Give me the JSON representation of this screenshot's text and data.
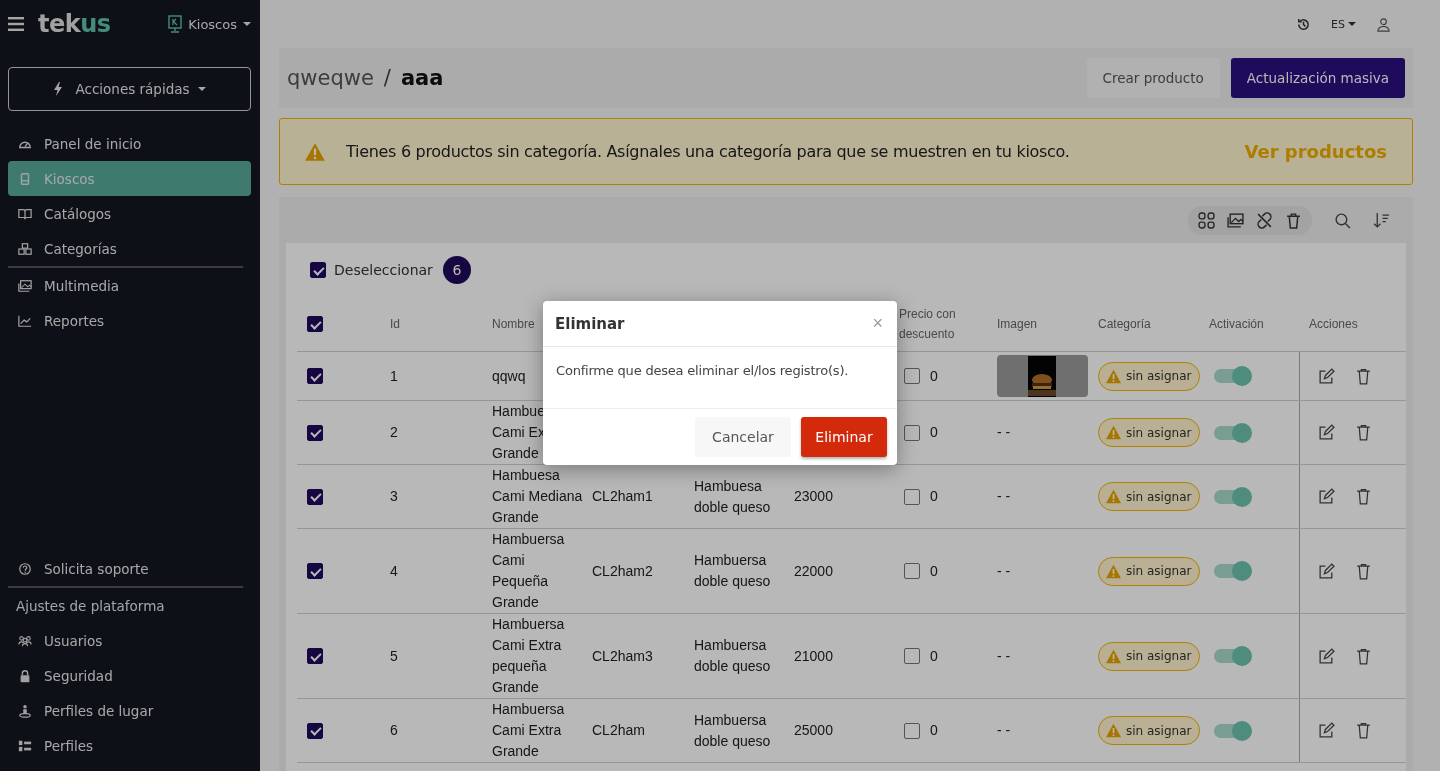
{
  "sidebar": {
    "logo": {
      "main": "tek",
      "accent": "us"
    },
    "kiosk_switch": "Kioscos",
    "quick_actions": "Acciones rápidas",
    "items": [
      {
        "label": "Panel de inicio",
        "selected": false
      },
      {
        "label": "Kioscos",
        "selected": true
      },
      {
        "label": "Catálogos",
        "selected": false
      },
      {
        "label": "Categorías",
        "selected": false
      },
      {
        "kind": "divider"
      },
      {
        "label": "Multimedia",
        "selected": false
      },
      {
        "label": "Reportes",
        "selected": false
      }
    ],
    "bottom_items": [
      {
        "label": "Solicita soporte",
        "selected": false
      },
      {
        "kind": "divider"
      },
      {
        "kind": "section",
        "label": "Ajustes de plataforma"
      },
      {
        "label": "Usuarios",
        "selected": false
      },
      {
        "label": "Seguridad",
        "selected": false
      },
      {
        "label": "Perfiles de lugar",
        "selected": false
      },
      {
        "label": "Perfiles",
        "selected": false
      }
    ]
  },
  "top_bar": {
    "language": "ES"
  },
  "header": {
    "parent": "qweqwe",
    "separator": "/",
    "current": "aaa",
    "buttons": [
      {
        "label": "Crear producto",
        "kind": "secondary"
      },
      {
        "label": "Actualización masiva",
        "kind": "primary"
      }
    ]
  },
  "alert": {
    "text": "Tienes 6 productos sin categoría. Asígnales una categoría para que se muestren en tu kiosco.",
    "link": "Ver productos"
  },
  "selection": {
    "checked": true,
    "label": "Deseleccionar",
    "count": "6"
  },
  "table": {
    "header_checked": true,
    "headers": {
      "id": "Id",
      "name": "Nombre",
      "discount": "Precio con descuento",
      "image": "Imagen",
      "category": "Categoría",
      "activation": "Activación",
      "actions": "Acciones"
    },
    "rows": [
      {
        "checked": true,
        "id": "1",
        "name": "qqwq",
        "discount_checked": false,
        "discount": "0",
        "category": "sin asignar",
        "active": true
      },
      {
        "checked": true,
        "id": "2",
        "name": "Hambue\nCami Ex\nGrande",
        "discount_checked": false,
        "discount": "0",
        "image": {
          "kind": "text",
          "text": "- -"
        },
        "category": "sin asignar",
        "active": true
      },
      {
        "checked": true,
        "id": "3",
        "name": "Hambuesa\nCami Mediana\nGrande",
        "column_4": "CL2ham1",
        "column_5": "Hambuesa\ndoble queso",
        "column_6": "23000",
        "discount_checked": false,
        "discount": "0",
        "image": {
          "kind": "text",
          "text": "- -"
        },
        "category": "sin asignar",
        "active": true
      },
      {
        "checked": true,
        "id": "4",
        "name": "Hambuersa\nCami\nPequeña\nGrande",
        "column_4": "CL2ham2",
        "column_5": "Hambuersa\ndoble queso",
        "column_6": "22000",
        "discount_checked": false,
        "discount": "0",
        "image": {
          "kind": "text",
          "text": "- -"
        },
        "category": "sin asignar",
        "active": true
      },
      {
        "checked": true,
        "id": "5",
        "name": "Hambuersa\nCami Extra\npequeña\nGrande",
        "column_4": "CL2ham3",
        "column_5": "Hambuersa\ndoble queso",
        "column_6": "21000",
        "discount_checked": false,
        "discount": "0",
        "image": {
          "kind": "text",
          "text": "- -"
        },
        "category": "sin asignar",
        "active": true
      },
      {
        "checked": true,
        "id": "6",
        "name": "Hambuersa\nCami Extra\nGrande",
        "column_4": "CL2ham",
        "column_5": "Hambuersa\ndoble queso",
        "column_6": "25000",
        "discount_checked": false,
        "discount": "0",
        "image": {
          "kind": "text",
          "text": "- -"
        },
        "category": "sin asignar",
        "active": true
      }
    ]
  },
  "modal": {
    "title": "Eliminar",
    "close": "×",
    "message": "Confirme que desea eliminar el/los registro(s).",
    "buttons": [
      {
        "label": "Cancelar",
        "kind": "secondary"
      },
      {
        "label": "Eliminar",
        "kind": "danger"
      }
    ]
  }
}
